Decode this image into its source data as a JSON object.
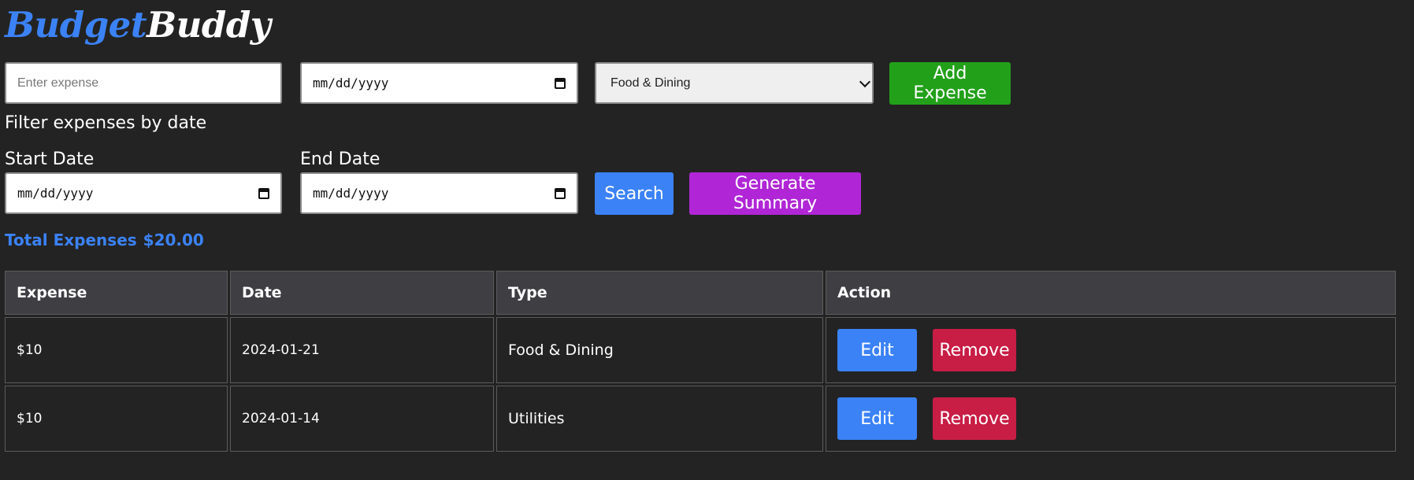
{
  "brand": {
    "part_a": "Budget",
    "part_b": "Buddy",
    "color_a": "#3b82f6"
  },
  "add_form": {
    "expense_placeholder": "Enter expense",
    "date_value": "mm/dd/yyyy",
    "type_selected": "Food & Dining",
    "add_label": "Add Expense"
  },
  "filter": {
    "heading": "Filter expenses by date",
    "start_label": "Start Date",
    "start_value": "mm/dd/yyyy",
    "end_label": "End Date",
    "end_value": "mm/dd/yyyy",
    "search_label": "Search",
    "summary_label": "Generate Summary"
  },
  "total": {
    "label": "Total Expenses",
    "value": "$20.00"
  },
  "table": {
    "headers": [
      "Expense",
      "Date",
      "Type",
      "Action"
    ],
    "rows": [
      {
        "expense": "$10",
        "date": "2024-01-21",
        "type": "Food & Dining",
        "edit": "Edit",
        "remove": "Remove"
      },
      {
        "expense": "$10",
        "date": "2024-01-14",
        "type": "Utilities",
        "edit": "Edit",
        "remove": "Remove"
      }
    ]
  },
  "colors": {
    "background": "#232323",
    "add_button": "#22a01a",
    "primary_button": "#3b82f6",
    "summary_button": "#b026d6",
    "remove_button": "#c81d45",
    "table_header": "#3e3e43"
  }
}
